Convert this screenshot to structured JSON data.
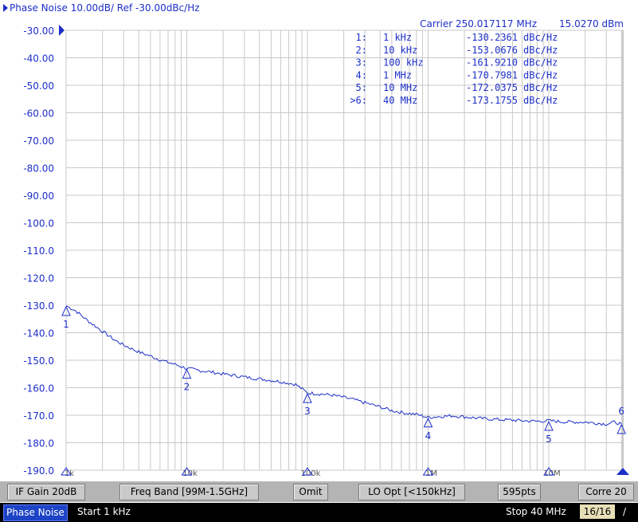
{
  "title": "Phase Noise 10.00dB/ Ref -30.00dBc/Hz",
  "carrier_label": "Carrier 250.017117 MHz",
  "carrier_power": "15.0270 dBm",
  "marker_table": [
    {
      "id": "1:",
      "freq": "1 kHz",
      "value": "-130.2361",
      "unit": "dBc/Hz"
    },
    {
      "id": "2:",
      "freq": "10 kHz",
      "value": "-153.0676",
      "unit": "dBc/Hz"
    },
    {
      "id": "3:",
      "freq": "100 kHz",
      "value": "-161.9210",
      "unit": "dBc/Hz"
    },
    {
      "id": "4:",
      "freq": "1 MHz",
      "value": "-170.7981",
      "unit": "dBc/Hz"
    },
    {
      "id": "5:",
      "freq": "10 MHz",
      "value": "-172.0375",
      "unit": "dBc/Hz"
    },
    {
      "id": ">6:",
      "freq": "40 MHz",
      "value": "-173.1755",
      "unit": "dBc/Hz"
    }
  ],
  "y_ticks": [
    "-30.00",
    "-40.00",
    "-50.00",
    "-60.00",
    "-70.00",
    "-80.00",
    "-90.00",
    "-100.0",
    "-110.0",
    "-120.0",
    "-130.0",
    "-140.0",
    "-150.0",
    "-160.0",
    "-170.0",
    "-180.0",
    "-190.0"
  ],
  "x_tick_labels": [
    "1k",
    "10k",
    "100k",
    "1M",
    "10M"
  ],
  "softkeys": [
    "IF Gain 20dB",
    "Freq Band [99M-1.5GHz]",
    "Omit",
    "LO Opt [<150kHz]",
    "595pts",
    "Corre 20"
  ],
  "status": {
    "measurement": "Phase Noise",
    "start": "Start 1 kHz",
    "stop": "Stop 40 MHz",
    "trace_count": "16/16",
    "slash": "/"
  },
  "colors": {
    "trace": "#1d2fc8",
    "grid": "#c8c8c8",
    "text": "#1d2fc8",
    "background": "#ffffff"
  },
  "chart_data": {
    "type": "line",
    "x_scale": "log",
    "xlim": [
      1000,
      40000000
    ],
    "ylim": [
      -190,
      -30
    ],
    "x_unit": "Hz",
    "y_unit": "dBc/Hz",
    "grid": true,
    "series": [
      {
        "x": [
          1000,
          1200,
          1500,
          2000,
          2500,
          3000,
          4000,
          5000,
          6000,
          7000,
          8000,
          10000,
          13000,
          16000,
          20000,
          25000,
          30000,
          40000,
          50000,
          60000,
          70000,
          80000,
          100000,
          130000,
          160000,
          200000,
          250000,
          300000,
          400000,
          500000,
          600000,
          800000,
          1000000,
          1300000,
          1600000,
          2000000,
          2500000,
          3000000,
          4000000,
          5000000,
          6000000,
          8000000,
          10000000,
          13000000,
          16000000,
          20000000,
          25000000,
          30000000,
          35000000,
          40000000
        ],
        "y": [
          -130.2,
          -132,
          -135.5,
          -139.5,
          -142.5,
          -144.5,
          -147,
          -148.5,
          -149.8,
          -150.8,
          -151.5,
          -153,
          -153.8,
          -154.3,
          -155,
          -155.6,
          -156.1,
          -156.8,
          -157.3,
          -157.8,
          -158.3,
          -158.8,
          -161.9,
          -162.3,
          -162.7,
          -163.5,
          -164.5,
          -165.5,
          -167,
          -168.3,
          -169,
          -169.7,
          -170.8,
          -170.4,
          -170.2,
          -170.6,
          -171,
          -171.3,
          -171.6,
          -171.8,
          -172,
          -172.2,
          -172.0,
          -172.4,
          -172.5,
          -172.5,
          -172.9,
          -173.2,
          -172.5,
          -173.2
        ]
      }
    ],
    "markers": [
      {
        "label": "1",
        "x": 1000,
        "y": -130.2361
      },
      {
        "label": "2",
        "x": 10000,
        "y": -153.0676
      },
      {
        "label": "3",
        "x": 100000,
        "y": -161.921
      },
      {
        "label": "4",
        "x": 1000000,
        "y": -170.7981
      },
      {
        "label": "5",
        "x": 10000000,
        "y": -172.0375
      },
      {
        "label": "6",
        "x": 40000000,
        "y": -173.1755
      }
    ]
  }
}
